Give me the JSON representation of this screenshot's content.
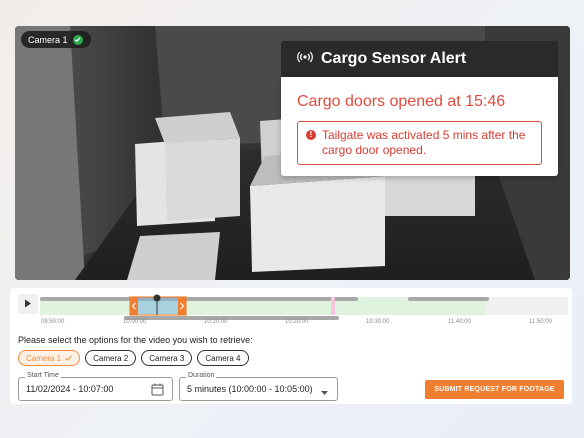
{
  "video": {
    "camera_badge": "Camera 1",
    "camera_status_icon": "check-circle-icon"
  },
  "alert": {
    "header_title": "Cargo Sensor Alert",
    "header_icon": "sensor-signal-icon",
    "title": "Cargo doors opened at 15:46",
    "message": "Tailgate was activated 5 mins after the cargo door opened.",
    "message_icon": "error-icon",
    "accent_color": "#e04b3f"
  },
  "timeline": {
    "play_icon": "play-icon",
    "ticks": [
      "09:50:00",
      "10:00:00",
      "10:10:00",
      "10:20:00",
      "10:30:00",
      "11:40:00",
      "11:50:00"
    ]
  },
  "form": {
    "prompt": "Please select the options for the video you wish to retrieve:",
    "cameras": [
      {
        "label": "Camera 1",
        "selected": true
      },
      {
        "label": "Camera 2",
        "selected": false
      },
      {
        "label": "Camera 3",
        "selected": false
      },
      {
        "label": "Camera 4",
        "selected": false
      }
    ],
    "start_time_label": "Start Time",
    "start_time_value": "11/02/2024 - 10:07:00",
    "duration_label": "Duration",
    "duration_value": "5 minutes (10:00:00 - 10:05:00)",
    "submit_label": "SUBMIT REQUEST FOR FOOTAGE",
    "accent_color": "#f07e30"
  }
}
